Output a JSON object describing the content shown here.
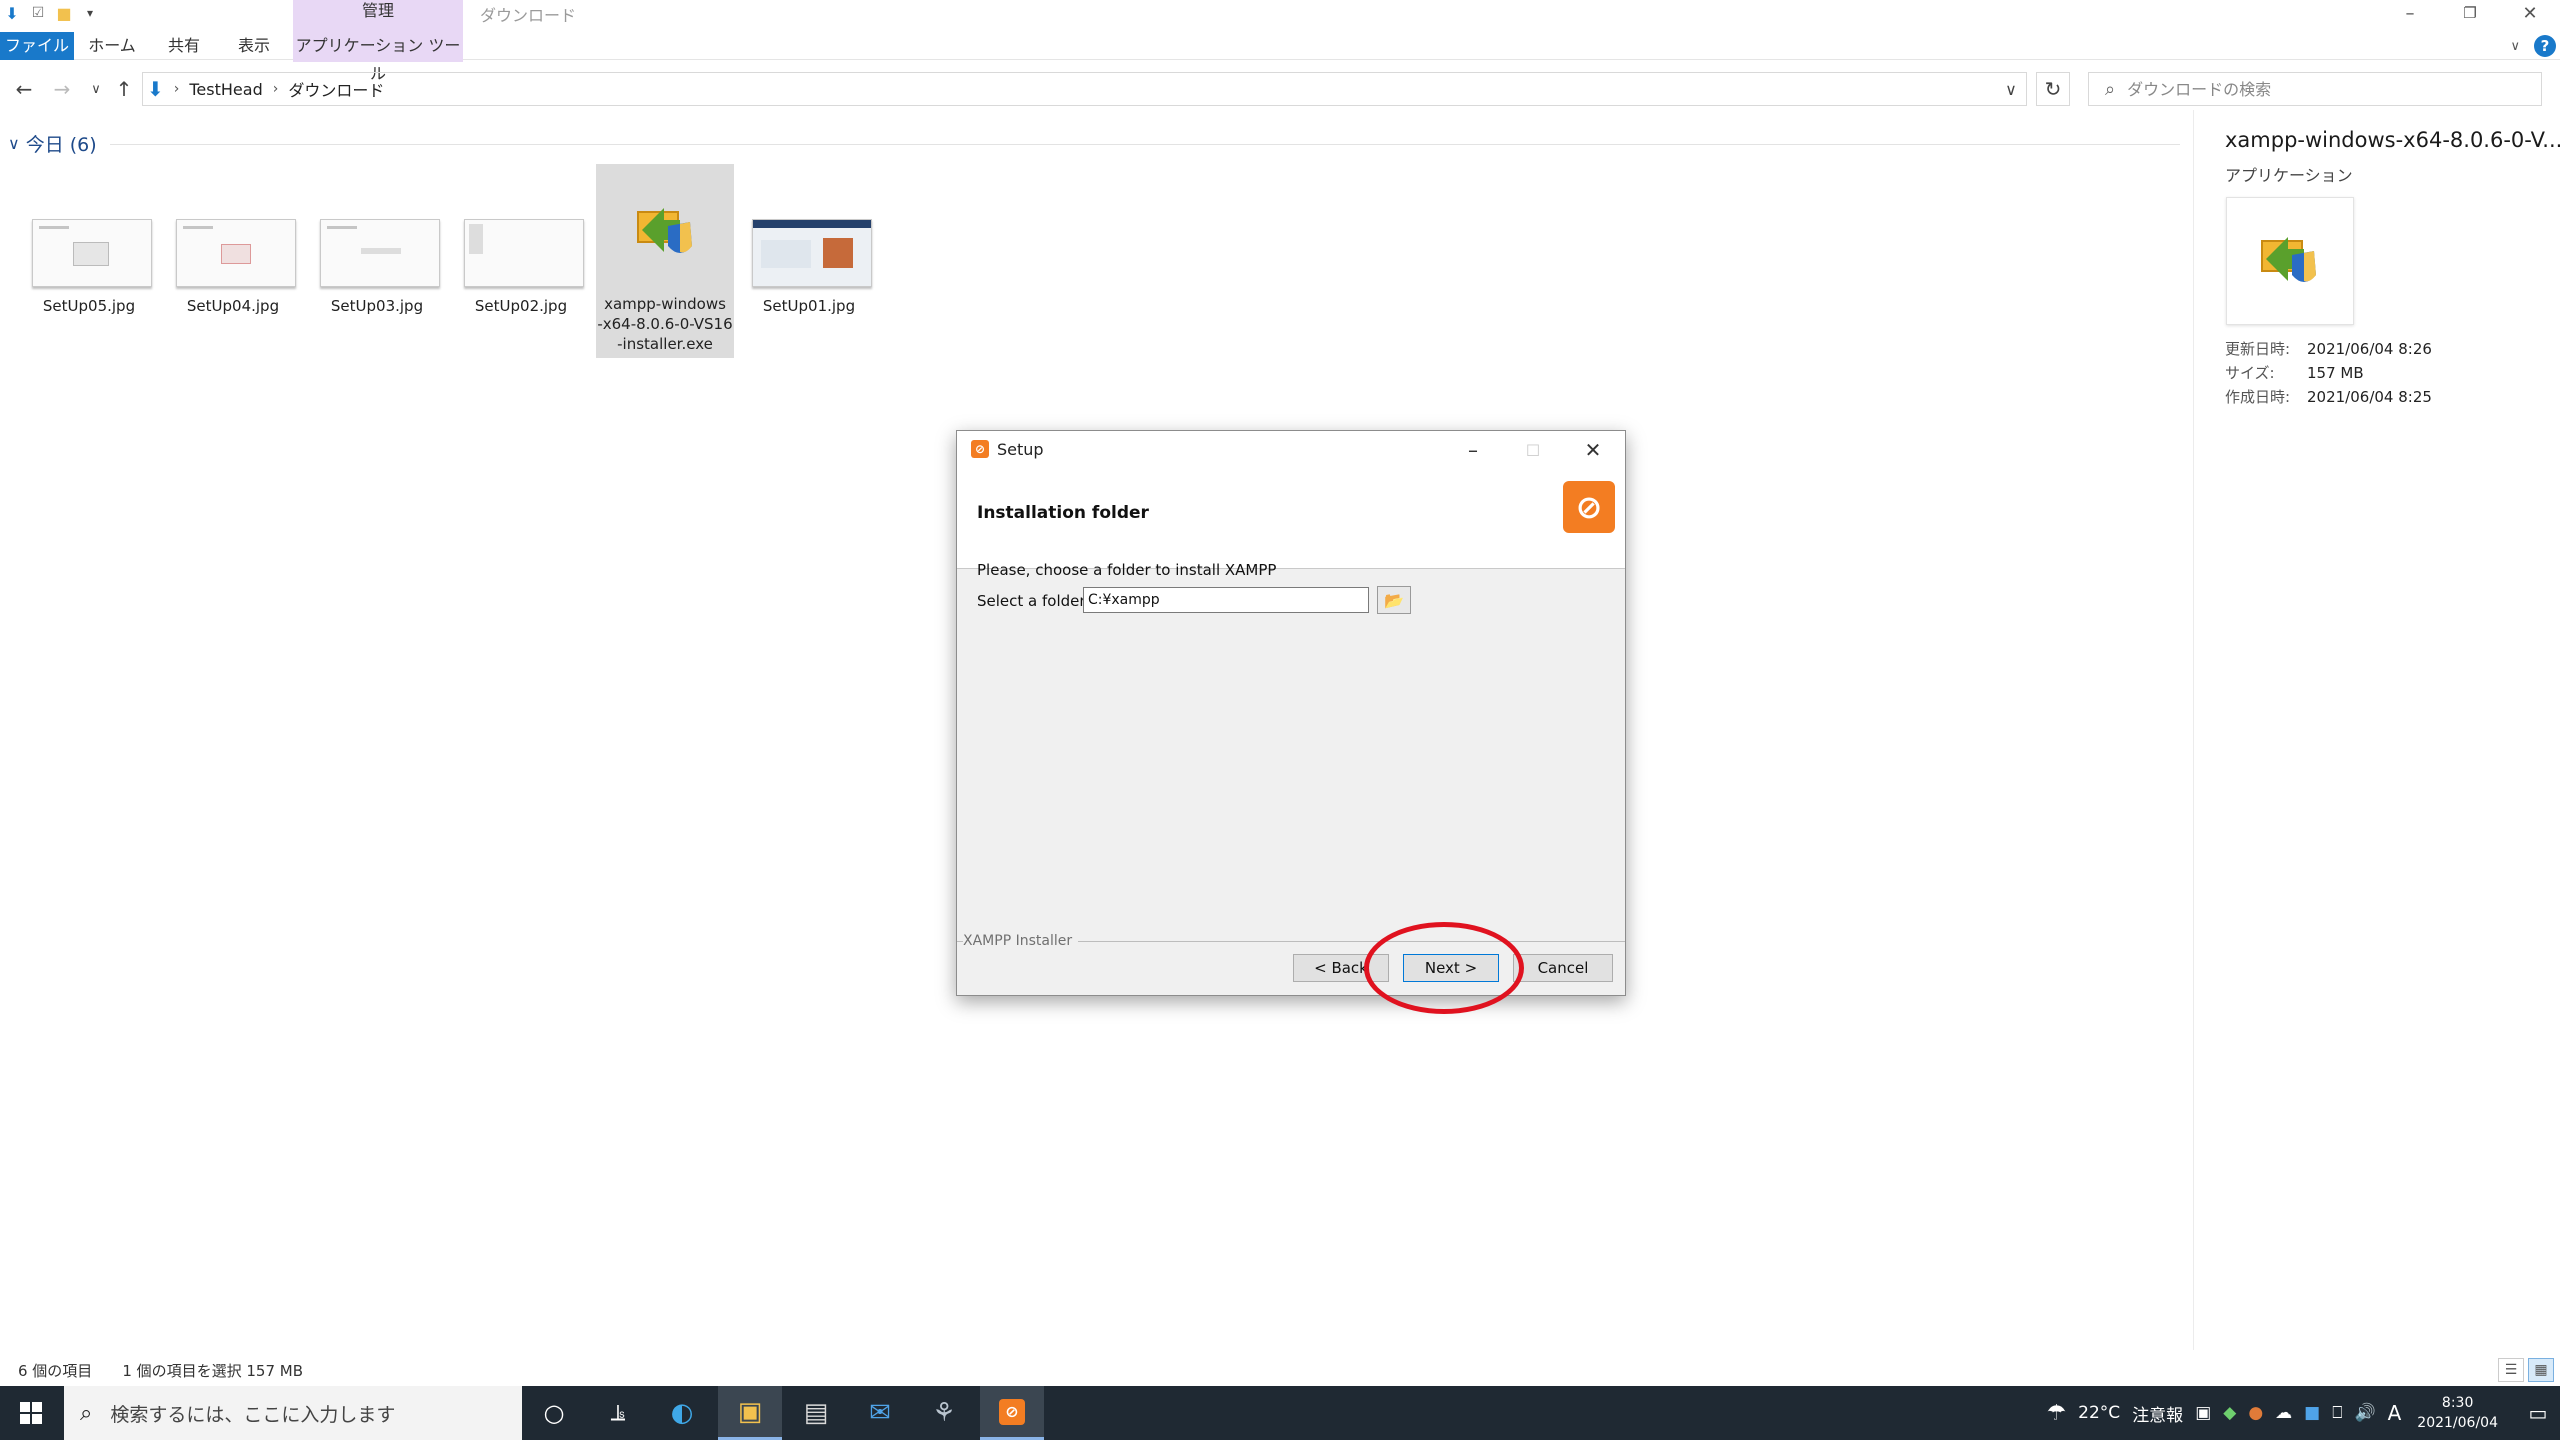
{
  "explorer": {
    "context_tab_group": "管理",
    "window_title": "ダウンロード",
    "tabs": {
      "file": "ファイル",
      "home": "ホーム",
      "share": "共有",
      "view": "表示",
      "app_tools": "アプリケーション ツール"
    },
    "breadcrumb": [
      "TestHead",
      "ダウンロード"
    ],
    "search_placeholder": "ダウンロードの検索",
    "group_label": "今日 (6)",
    "files": [
      {
        "name": "SetUp05.jpg",
        "selected": false
      },
      {
        "name": "SetUp04.jpg",
        "selected": false
      },
      {
        "name": "SetUp03.jpg",
        "selected": false
      },
      {
        "name": "SetUp02.jpg",
        "selected": false
      },
      {
        "name": "xampp-windows\n-x64-8.0.6-0-VS16\n-installer.exe",
        "selected": true
      },
      {
        "name": "SetUp01.jpg",
        "selected": false
      }
    ],
    "details": {
      "name": "xampp-windows-x64-8.0.6-0-V...",
      "type": "アプリケーション",
      "rows": [
        {
          "key": "更新日時:",
          "value": "2021/06/04 8:26"
        },
        {
          "key": "サイズ:",
          "value": "157 MB"
        },
        {
          "key": "作成日時:",
          "value": "2021/06/04 8:25"
        }
      ]
    },
    "status": {
      "count": "6 個の項目",
      "selection": "1 個の項目を選択 157 MB"
    }
  },
  "dialog": {
    "title": "Setup",
    "heading": "Installation folder",
    "prompt": "Please, choose a folder to install XAMPP",
    "folder_label": "Select a folder",
    "folder_value": "C:¥xampp",
    "footer_label": "XAMPP Installer",
    "buttons": {
      "back": "< Back",
      "next": "Next >",
      "cancel": "Cancel"
    }
  },
  "taskbar": {
    "search_placeholder": "検索するには、ここに入力します",
    "weather_temp": "22°C",
    "weather_alert": "注意報",
    "ime": "A",
    "time": "8:30",
    "date": "2021/06/04"
  },
  "colors": {
    "ribbon_file_tab": "#1979ca",
    "context_tab": "#e8d8f5",
    "xampp_orange": "#f37d22",
    "highlight_red": "#e0121f",
    "taskbar_bg": "#1f2933"
  }
}
